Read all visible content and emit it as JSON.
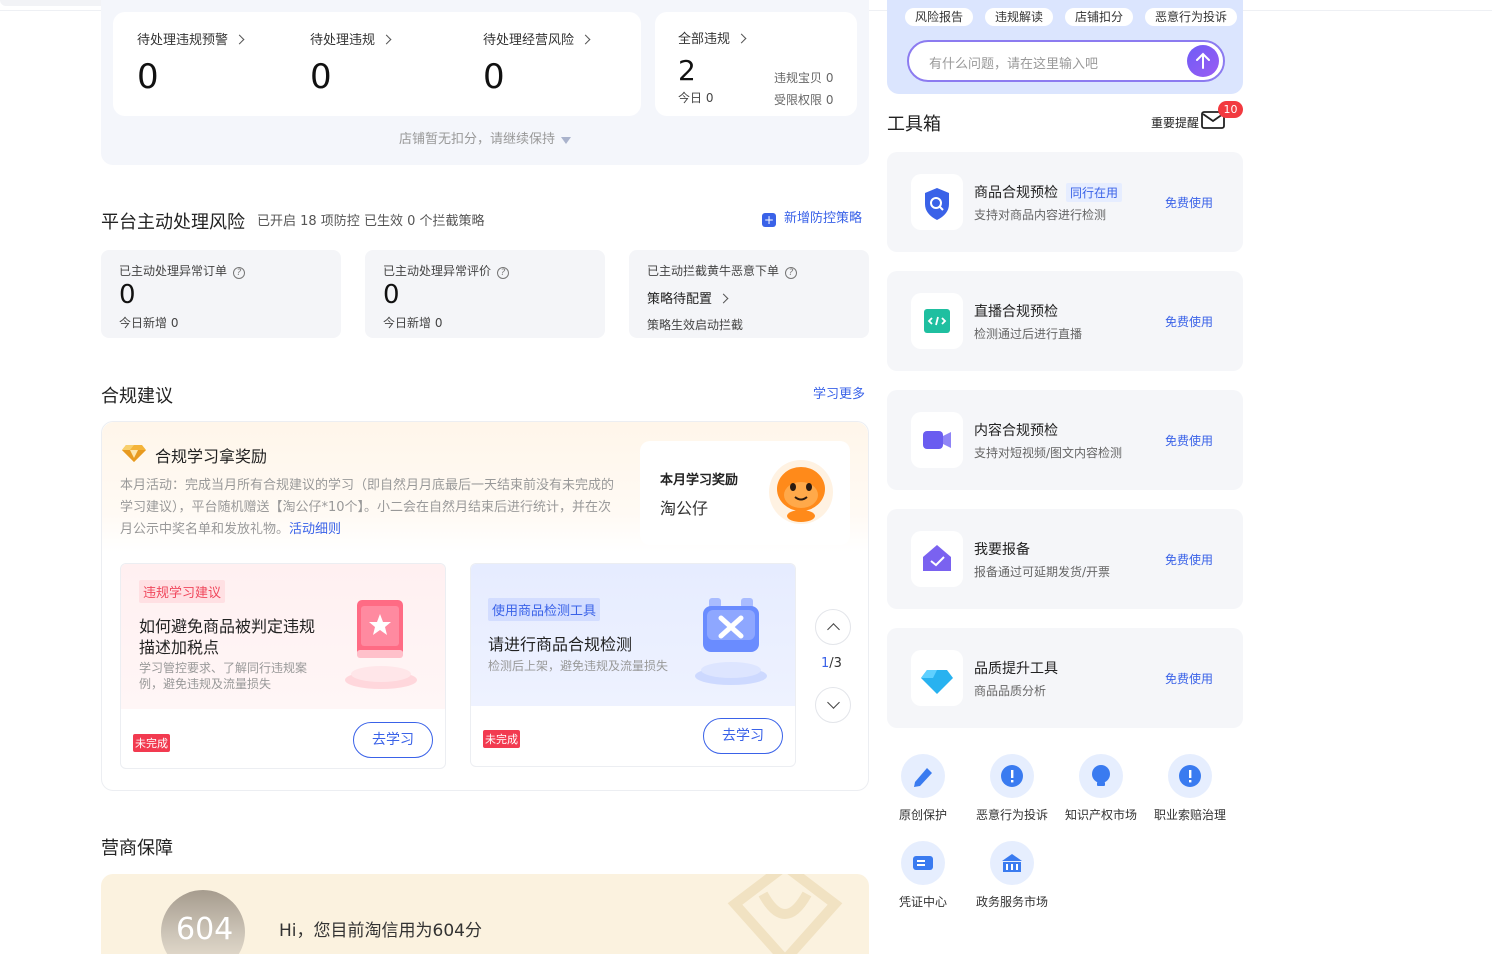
{
  "top_stats": {
    "warn_label": "待处理违规预警",
    "warn_value": "0",
    "violation_label": "待处理违规",
    "violation_value": "0",
    "biz_risk_label": "待处理经营风险",
    "biz_risk_value": "0",
    "all_label": "全部违规",
    "all_value": "2",
    "today_label": "今日 0",
    "item_violation": "违规宝贝 0",
    "restricted": "受限权限 0",
    "notice": "店铺暂无扣分，请继续保持"
  },
  "risk": {
    "title": "平台主动处理风险",
    "subtitle": "已开启 18 项防控 已生效 0 个拦截策略",
    "add_link": "新增防控策略",
    "cards": [
      {
        "label": "已主动处理异常订单",
        "value": "0",
        "foot": "今日新增 0"
      },
      {
        "label": "已主动处理异常评价",
        "value": "0",
        "foot": "今日新增 0"
      },
      {
        "label": "已主动拦截黄牛恶意下单",
        "value": "策略待配置",
        "foot": "策略生效启动拦截"
      }
    ]
  },
  "compliance": {
    "title": "合规建议",
    "more_link": "学习更多",
    "reward_title": "合规学习拿奖励",
    "reward_desc": "本月活动：完成当月所有合规建议的学习（即自然月月底最后一天结束前没有未完成的学习建议），平台随机赠送【淘公仔*10个】。小二会在自然月结束后进行统计，并在次月公示中奖名单和发放礼物。",
    "reward_link": "活动细则",
    "month_reward_label": "本月学习奖励",
    "month_reward_value": "淘公仔",
    "cards": [
      {
        "tag": "违规学习建议",
        "title": "如何避免商品被判定违规描述加税点",
        "desc": "学习管控要求、了解同行违规案例，避免违规及流量损失",
        "status": "未完成",
        "button": "去学习"
      },
      {
        "tag": "使用商品检测工具",
        "title": "请进行商品合规检测",
        "desc": "检测后上架，避免违规及流量损失",
        "status": "未完成",
        "button": "去学习"
      }
    ],
    "page_current": "1",
    "page_total": "/3"
  },
  "guarantee": {
    "title": "营商保障",
    "score": "604",
    "greeting": "Hi，您目前淘信用为604分"
  },
  "assistant": {
    "chips": [
      "风险报告",
      "违规解读",
      "店铺扣分",
      "恶意行为投诉"
    ],
    "placeholder": "有什么问题，请在这里输入吧"
  },
  "toolbox": {
    "title": "工具箱",
    "reminder": "重要提醒",
    "badge": "10",
    "tools": [
      {
        "name": "商品合规预检",
        "tag": "同行在用",
        "desc": "支持对商品内容进行检测",
        "action": "免费使用",
        "icon": "shield-search-icon",
        "color": "#3a62e8"
      },
      {
        "name": "直播合规预检",
        "tag": "",
        "desc": "检测通过后进行直播",
        "action": "免费使用",
        "icon": "code-screen-icon",
        "color": "#1fbfa0"
      },
      {
        "name": "内容合规预检",
        "tag": "",
        "desc": "支持对短视频/图文内容检测",
        "action": "免费使用",
        "icon": "video-camera-icon",
        "color": "#6a5cf0"
      },
      {
        "name": "我要报备",
        "tag": "",
        "desc": "报备通过可延期发货/开票",
        "action": "免费使用",
        "icon": "house-check-icon",
        "color": "#7a62f0"
      },
      {
        "name": "品质提升工具",
        "tag": "",
        "desc": "商品品质分析",
        "action": "免费使用",
        "icon": "diamond-icon",
        "color": "#28b2f0"
      }
    ],
    "quick_links": [
      {
        "label": "原创保护",
        "icon": "pen-shield-icon"
      },
      {
        "label": "恶意行为投诉",
        "icon": "alert-icon"
      },
      {
        "label": "知识产权市场",
        "icon": "bulb-icon"
      },
      {
        "label": "职业索赔治理",
        "icon": "alert-icon"
      },
      {
        "label": "凭证中心",
        "icon": "ticket-icon"
      },
      {
        "label": "政务服务市场",
        "icon": "bank-icon"
      }
    ]
  }
}
